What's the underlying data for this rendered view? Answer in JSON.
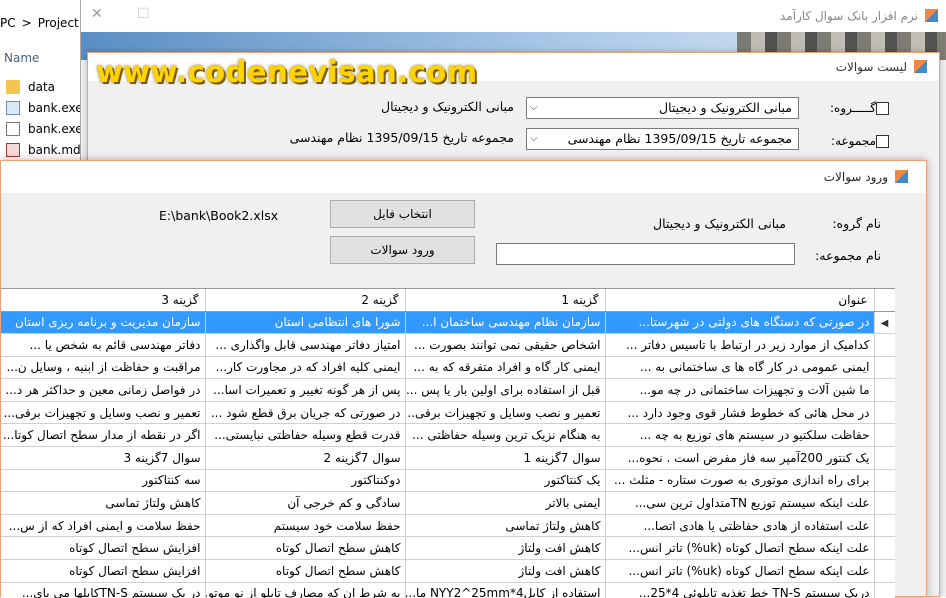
{
  "explorer": {
    "crumbs": [
      "PC",
      ">",
      "Project"
    ],
    "column_header": "Name",
    "files": [
      {
        "name": "data",
        "icon": "folder-icon"
      },
      {
        "name": "bank.exe",
        "icon": "exe-file-icon"
      },
      {
        "name": "bank.exe.",
        "icon": "config-file-icon"
      },
      {
        "name": "bank.mdb",
        "icon": "database-file-icon"
      }
    ]
  },
  "main_window": {
    "title": "نرم افزار بانک سوال کارآمد",
    "controls": {
      "close": "✕",
      "maximize": "☐"
    }
  },
  "list_window": {
    "title": "لیست سوالات",
    "watermark": "www.codenevisan.com",
    "group_label": "گـــــروه:",
    "group_value": "مبانی الکترونیک و دیجیتال",
    "group_text": "مبانی الکترونیک و دیجیتال",
    "collection_label": "مجموعه:",
    "collection_value": "مجموعه تاریخ 1395/09/15 نظام مهندسی",
    "collection_text": "مجموعه تاریخ 1395/09/15 نظام مهندسی"
  },
  "import_window": {
    "title": "ورود سوالات",
    "file_path": "E:\\bank\\Book2.xlsx",
    "select_file_button": "انتخاب فایل",
    "import_button": "ورود سوالات",
    "group_name_label": "نام گروه:",
    "group_name_value": "مبانی الکترونیک و دیجیتال",
    "collection_name_label": "نام مجموعه:",
    "collection_name_value": "",
    "grid": {
      "columns": [
        "عنوان",
        "گزینه 1",
        "گزینه 2",
        "گزینه 3"
      ],
      "selected_row": 0,
      "rows": [
        [
          "در صورتی که دستگاه های دولتی در شهرستا...",
          "سازمان نظام مهندسی ساختمان ا...",
          "شورا های انتظامی استان",
          "سازمان مدیریت و برنامه ریزی استان"
        ],
        [
          "کدامیک از موارد زیر در ارتباط با تاسیس دفاتر ...",
          "اشخاص حقیقی نمی توانند بصورت ...",
          "امتیاز دفاتر مهندسی قابل واگذاری ...",
          "دفاتر مهندسی قائم به شخص یا ..."
        ],
        [
          "ایمنی عمومی در کار گاه ها ی ساختمانی به ...",
          "ایمنی کار گاه و افراد متفرقه که به ...",
          "ایمنی کلیه افراد که در مجاورت کار...",
          "مراقبت و حفاظت از ابنیه ، وسایل ن..."
        ],
        [
          "ما شین آلات و تجهیزات ساختمانی در چه مو...",
          "قبل از استفاده برای اولین بار یا پس ...",
          "پس از هر گونه تغییر و تعمیرات اسا...",
          "در فواصل زمانی معین و حداکثر هر د..."
        ],
        [
          "در محل هائی که خطوط فشار قوی وجود دارد ...",
          "تعمیر و نصب وسایل و تجهیزات برقی...",
          "در صورتی که جریان برق قطع شود ...",
          "تعمیر و نصب وسایل و تجهیزات برقی..."
        ],
        [
          "حفاظت سلکتیو در سیستم های توزیع به چه ...",
          "به هنگام نزیک ترین وسیله حفاظتی ...",
          "قدرت قطع وسیله حفاظتی نبایستی...",
          "اگر در نقطه از مدار سطح اتصال کوتا..."
        ],
        [
          "یک کنتور 200آمپر سه فاز مفرض است . نحوه...",
          "سوال 7گزینه 1",
          "سوال 7گزینه 2",
          "سوال 7گزینه 3"
        ],
        [
          "برای راه اندازی موتوری به صورت ستاره - مثلث ...",
          "یک کنتاکتور",
          "دوکنتاکتور",
          "سه کنتاکتور"
        ],
        [
          "علت اینکه سیستم توزیع TNمتداول ترین سی...",
          "ایمنی بالاتر",
          "سادگی و کم خرجی آن",
          "کاهش ولتاژ تماسی"
        ],
        [
          "علت استفاده از هادی حفاظتی یا هادی اتصا...",
          "کاهش ولتاژ تماسی",
          "حفظ سلامت خود سیستم",
          "حفظ سلامت و ایمنی افراد که از س..."
        ],
        [
          "علت اینکه سطح اتصال کوتاه (uk%) تاتر انس...",
          "کاهش افت ولتاژ",
          "کاهش سطح اتصال کوتاه",
          "افزایش سطح اتصال کوتاه"
        ],
        [
          "علت اینکه سطح اتصال کوتاه (uk%) تاتر انس...",
          "کاهش افت ولتاژ",
          "کاهش سطح اتصال کوتاه",
          "افزایش سطح اتصال کوتاه"
        ],
        [
          "دریک سیستم TN-S خط تغذیه تابلوئی 4*25...",
          "استفاده از کابل4*NYY2^25mm ما...",
          "به شرط ان که مصارف تابلو از نو موتو...",
          "در یک سیستم TN-Sکابلها می بای..."
        ]
      ]
    }
  },
  "colors": {
    "selection": "#3399ff",
    "window_border": "#e9a27a",
    "watermark": "#ffd400"
  }
}
